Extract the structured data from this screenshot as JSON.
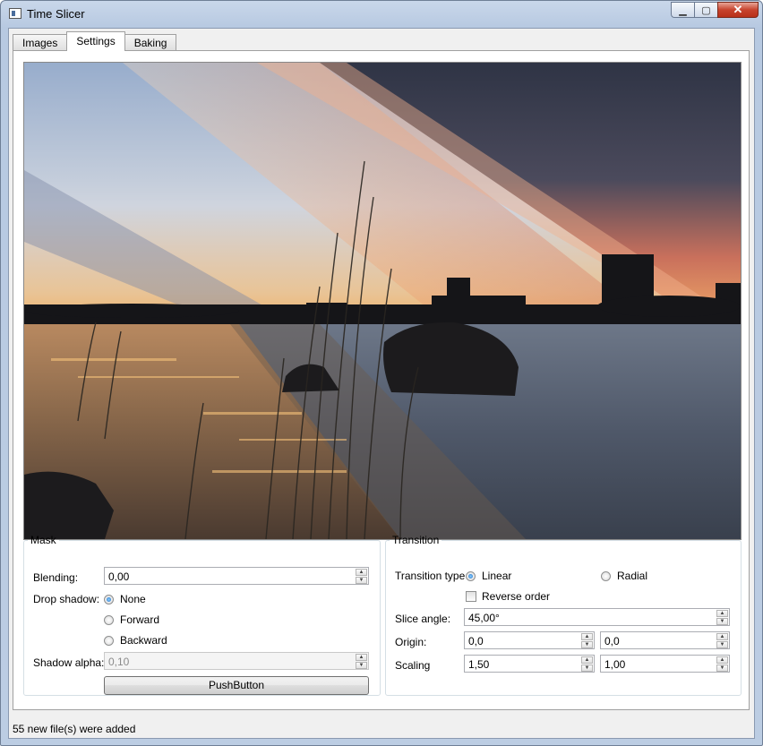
{
  "window": {
    "title": "Time Slicer"
  },
  "tabs": [
    {
      "label": "Images",
      "active": false
    },
    {
      "label": "Settings",
      "active": true
    },
    {
      "label": "Baking",
      "active": false
    }
  ],
  "mask": {
    "title": "Mask",
    "blending_label": "Blending:",
    "blending_value": "0,00",
    "drop_shadow_label": "Drop shadow:",
    "drop_shadow_options": [
      {
        "label": "None",
        "selected": true
      },
      {
        "label": "Forward",
        "selected": false
      },
      {
        "label": "Backward",
        "selected": false
      }
    ],
    "shadow_alpha_label": "Shadow alpha:",
    "shadow_alpha_value": "0,10",
    "push_button_label": "PushButton"
  },
  "transition": {
    "title": "Transition",
    "type_label": "Transition type",
    "type_options": [
      {
        "label": "Linear",
        "selected": true
      },
      {
        "label": "Radial",
        "selected": false
      }
    ],
    "reverse_order_label": "Reverse order",
    "reverse_order_checked": false,
    "slice_angle_label": "Slice angle:",
    "slice_angle_value": "45,00°",
    "origin_label": "Origin:",
    "origin_x": "0,0",
    "origin_y": "0,0",
    "scaling_label": "Scaling",
    "scaling_x": "1,50",
    "scaling_y": "1,00"
  },
  "status": {
    "message": "55 new file(s) were added"
  },
  "colors": {
    "selection_accent": "#1c6fc7",
    "sunset": "#e8774a",
    "dusk_sky": "#3a4152"
  }
}
